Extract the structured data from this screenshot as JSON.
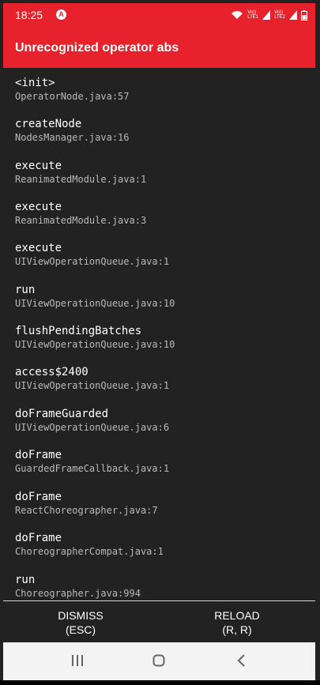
{
  "status_bar": {
    "time": "18:25",
    "notification_badge": "A",
    "sim1": "Vo))\nLTE1",
    "sim2": "Vo))\nLTE2",
    "icons": [
      "wifi-icon",
      "signal-icon",
      "signal-icon",
      "battery-icon"
    ]
  },
  "header": {
    "title": "Unrecognized operator abs"
  },
  "stack": [
    {
      "method": "<init>",
      "file": "OperatorNode.java:57"
    },
    {
      "method": "createNode",
      "file": "NodesManager.java:16"
    },
    {
      "method": "execute",
      "file": "ReanimatedModule.java:1"
    },
    {
      "method": "execute",
      "file": "ReanimatedModule.java:3"
    },
    {
      "method": "execute",
      "file": "UIViewOperationQueue.java:1"
    },
    {
      "method": "run",
      "file": "UIViewOperationQueue.java:10"
    },
    {
      "method": "flushPendingBatches",
      "file": "UIViewOperationQueue.java:10"
    },
    {
      "method": "access$2400",
      "file": "UIViewOperationQueue.java:1"
    },
    {
      "method": "doFrameGuarded",
      "file": "UIViewOperationQueue.java:6"
    },
    {
      "method": "doFrame",
      "file": "GuardedFrameCallback.java:1"
    },
    {
      "method": "doFrame",
      "file": "ReactChoreographer.java:7"
    },
    {
      "method": "doFrame",
      "file": "ChoreographerCompat.java:1"
    },
    {
      "method": "run",
      "file": "Choreographer.java:994"
    }
  ],
  "buttons": {
    "dismiss_line1": "DISMISS",
    "dismiss_line2": "(ESC)",
    "reload_line1": "RELOAD",
    "reload_line2": "(R, R)"
  },
  "navbar": {
    "icons": [
      "recents-icon",
      "home-icon",
      "back-icon"
    ]
  },
  "colors": {
    "header_red": "#e8222c",
    "background": "#222222",
    "navbar_bg": "#f3f3f3"
  }
}
